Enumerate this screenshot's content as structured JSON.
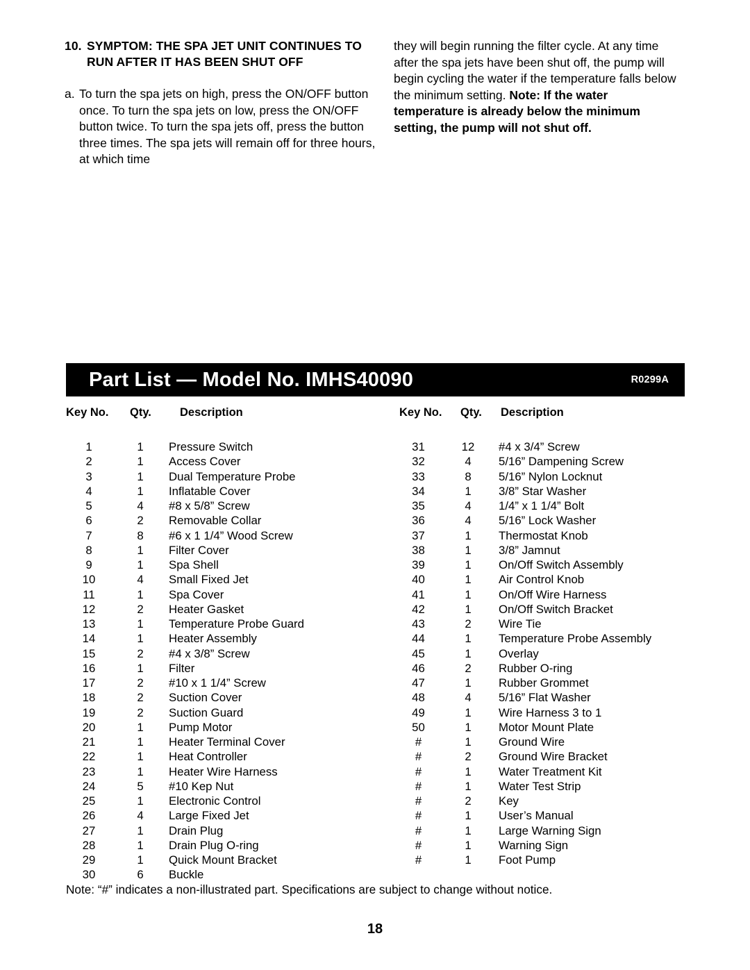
{
  "troubleshooting": {
    "number": "10.",
    "heading": "SYMPTOM: THE SPA JET UNIT CONTINUES TO RUN AFTER IT HAS BEEN SHUT OFF",
    "step_marker": "a.",
    "step_text": "To turn the spa jets on high, press the ON/OFF button once. To turn the spa jets on low, press the ON/OFF button twice. To turn the spa jets off, press the button three times. The spa jets will remain off for three hours, at which time",
    "continuation_normal": "they will begin running the filter cycle. At any time after the spa jets have been shut off, the pump will begin cycling the water if the temperature falls below the minimum setting. ",
    "continuation_bold": "Note: If the water temperature is already below the minimum setting, the pump will not shut off."
  },
  "banner": {
    "title": "Part List — Model No. IMHS40090",
    "revision": "R0299A",
    "background_color": "#000000",
    "text_color": "#ffffff"
  },
  "table": {
    "headers": {
      "key_no": "Key No.",
      "qty": "Qty.",
      "description": "Description"
    },
    "left_rows": [
      {
        "key": "1",
        "qty": "1",
        "desc": "Pressure Switch"
      },
      {
        "key": "2",
        "qty": "1",
        "desc": "Access Cover"
      },
      {
        "key": "3",
        "qty": "1",
        "desc": "Dual Temperature Probe"
      },
      {
        "key": "4",
        "qty": "1",
        "desc": "Inflatable Cover"
      },
      {
        "key": "5",
        "qty": "4",
        "desc": "#8 x 5/8” Screw"
      },
      {
        "key": "6",
        "qty": "2",
        "desc": "Removable Collar"
      },
      {
        "key": "7",
        "qty": "8",
        "desc": "#6 x 1 1/4” Wood Screw"
      },
      {
        "key": "8",
        "qty": "1",
        "desc": "Filter Cover"
      },
      {
        "key": "9",
        "qty": "1",
        "desc": "Spa Shell"
      },
      {
        "key": "10",
        "qty": "4",
        "desc": "Small Fixed Jet"
      },
      {
        "key": "11",
        "qty": "1",
        "desc": "Spa Cover"
      },
      {
        "key": "12",
        "qty": "2",
        "desc": "Heater Gasket"
      },
      {
        "key": "13",
        "qty": "1",
        "desc": "Temperature Probe Guard"
      },
      {
        "key": "14",
        "qty": "1",
        "desc": "Heater Assembly"
      },
      {
        "key": "15",
        "qty": "2",
        "desc": "#4 x 3/8” Screw"
      },
      {
        "key": "16",
        "qty": "1",
        "desc": "Filter"
      },
      {
        "key": "17",
        "qty": "2",
        "desc": "#10 x 1 1/4” Screw"
      },
      {
        "key": "18",
        "qty": "2",
        "desc": "Suction Cover"
      },
      {
        "key": "19",
        "qty": "2",
        "desc": "Suction Guard"
      },
      {
        "key": "20",
        "qty": "1",
        "desc": "Pump Motor"
      },
      {
        "key": "21",
        "qty": "1",
        "desc": "Heater Terminal Cover"
      },
      {
        "key": "22",
        "qty": "1",
        "desc": "Heat Controller"
      },
      {
        "key": "23",
        "qty": "1",
        "desc": "Heater Wire Harness"
      },
      {
        "key": "24",
        "qty": "5",
        "desc": "#10 Kep Nut"
      },
      {
        "key": "25",
        "qty": "1",
        "desc": "Electronic Control"
      },
      {
        "key": "26",
        "qty": "4",
        "desc": "Large Fixed Jet"
      },
      {
        "key": "27",
        "qty": "1",
        "desc": "Drain Plug"
      },
      {
        "key": "28",
        "qty": "1",
        "desc": "Drain Plug O-ring"
      },
      {
        "key": "29",
        "qty": "1",
        "desc": "Quick Mount Bracket"
      },
      {
        "key": "30",
        "qty": "6",
        "desc": "Buckle"
      }
    ],
    "right_rows": [
      {
        "key": "31",
        "qty": "12",
        "desc": "#4 x 3/4” Screw"
      },
      {
        "key": "32",
        "qty": "4",
        "desc": "5/16” Dampening Screw"
      },
      {
        "key": "33",
        "qty": "8",
        "desc": "5/16” Nylon Locknut"
      },
      {
        "key": "34",
        "qty": "1",
        "desc": "3/8” Star Washer"
      },
      {
        "key": "35",
        "qty": "4",
        "desc": "1/4” x 1 1/4” Bolt"
      },
      {
        "key": "36",
        "qty": "4",
        "desc": "5/16” Lock Washer"
      },
      {
        "key": "37",
        "qty": "1",
        "desc": "Thermostat Knob"
      },
      {
        "key": "38",
        "qty": "1",
        "desc": "3/8” Jamnut"
      },
      {
        "key": "39",
        "qty": "1",
        "desc": "On/Off Switch Assembly"
      },
      {
        "key": "40",
        "qty": "1",
        "desc": "Air Control Knob"
      },
      {
        "key": "41",
        "qty": "1",
        "desc": "On/Off Wire Harness"
      },
      {
        "key": "42",
        "qty": "1",
        "desc": "On/Off Switch Bracket"
      },
      {
        "key": "43",
        "qty": "2",
        "desc": "Wire Tie"
      },
      {
        "key": "44",
        "qty": "1",
        "desc": "Temperature Probe Assembly"
      },
      {
        "key": "45",
        "qty": "1",
        "desc": "Overlay"
      },
      {
        "key": "46",
        "qty": "2",
        "desc": "Rubber O-ring"
      },
      {
        "key": "47",
        "qty": "1",
        "desc": "Rubber Grommet"
      },
      {
        "key": "48",
        "qty": "4",
        "desc": "5/16” Flat Washer"
      },
      {
        "key": "49",
        "qty": "1",
        "desc": "Wire Harness 3 to 1"
      },
      {
        "key": "50",
        "qty": "1",
        "desc": "Motor Mount Plate"
      },
      {
        "key": "#",
        "qty": "1",
        "desc": "Ground Wire"
      },
      {
        "key": "#",
        "qty": "2",
        "desc": "Ground Wire Bracket"
      },
      {
        "key": "#",
        "qty": "1",
        "desc": "Water Treatment Kit"
      },
      {
        "key": "#",
        "qty": "1",
        "desc": "Water Test Strip"
      },
      {
        "key": "#",
        "qty": "2",
        "desc": "Key"
      },
      {
        "key": "#",
        "qty": "1",
        "desc": "User’s Manual"
      },
      {
        "key": "#",
        "qty": "1",
        "desc": "Large Warning Sign"
      },
      {
        "key": "#",
        "qty": "1",
        "desc": "Warning Sign"
      },
      {
        "key": "#",
        "qty": "1",
        "desc": "Foot Pump"
      }
    ]
  },
  "footnote": "Note: “#” indicates a non-illustrated part. Specifications are subject to change without notice.",
  "page_number": "18"
}
